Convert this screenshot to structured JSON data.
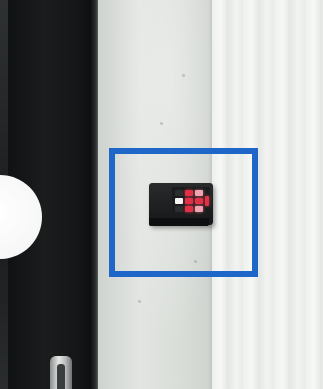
{
  "scene": {
    "objects": [
      "door",
      "door-window",
      "door-handle",
      "concrete-wall",
      "curtain",
      "wall-keypad-device"
    ],
    "annotation": {
      "shape": "rectangle",
      "color": "#1f66c9",
      "target": "wall-keypad-device"
    },
    "device_key_colors": [
      "#e03146",
      "#f2a3b0",
      "#f4f4f4"
    ]
  }
}
